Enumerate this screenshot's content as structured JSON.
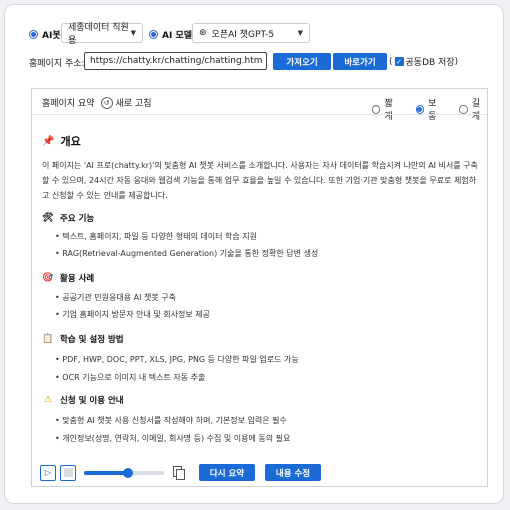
{
  "top": {
    "ai_bot_label": "AI봇",
    "ai_bot_select": "세종데이터 직원용",
    "ai_model_label": "AI 모델",
    "ai_model_select": "오픈AI 챗GPT-5",
    "homepage_label": "홈페이지 주소:",
    "url_value": "https://chatty.kr/chatting/chatting.htm",
    "fetch_button": "가져오기",
    "refetch_button": "바로가기",
    "open_paren": "(",
    "db_save_label": "공동DB 저장",
    "close_paren": ")"
  },
  "panel": {
    "summary_label": "홈페이지 요약",
    "refresh_label": "새로 고침",
    "length_options": [
      {
        "label": "짧게",
        "selected": false
      },
      {
        "label": "보통",
        "selected": true
      },
      {
        "label": "길게",
        "selected": false
      }
    ],
    "title": "개요",
    "intro": "이 페이지는 'AI 프로(chatty.kr)'의 맞춤형 AI 챗봇 서비스를 소개합니다. 사용자는 자사 데이터를 학습시켜 나만의 AI 비서를 구축할 수 있으며, 24시간 자동 응대와 웹검색 기능을 통해 업무 효율을 높일 수 있습니다. 또한 기업·기관 맞춤형 챗봇을 무료로 체험하고 신청할 수 있는 안내를 제공합니다.",
    "sections": [
      {
        "icon": "tools-icon",
        "heading": "주요 기능",
        "bullets": [
          "텍스트, 홈페이지, 파일 등 다양한 형태의 데이터 학습 지원",
          "RAG(Retrieval-Augmented Generation) 기술을 통한 정확한 답변 생성"
        ]
      },
      {
        "icon": "target-icon",
        "heading": "활용 사례",
        "bullets": [
          "공공기관 민원응대용 AI 챗봇 구축",
          "기업 홈페이지 방문자 안내 및 회사정보 제공"
        ]
      },
      {
        "icon": "clipboard-icon",
        "heading": "학습 및 설정 방법",
        "bullets": [
          "PDF, HWP, DOC, PPT, XLS, JPG, PNG 등 다양한 파일 업로드 가능",
          "OCR 기능으로 이미지 내 텍스트 자동 추출"
        ]
      },
      {
        "icon": "warning-icon",
        "heading": "신청 및 이용 안내",
        "bullets": [
          "맞춤형 AI 챗봇 사용 신청서를 작성해야 하며, 기본정보 입력은 필수",
          "개인정보(성명, 연락처, 이메일, 회사명 등) 수집 및 이용에 동의 필요"
        ]
      }
    ],
    "playback_volume": 0.55,
    "resummarize_button": "다시 요약",
    "edit_button": "내용 수정"
  }
}
